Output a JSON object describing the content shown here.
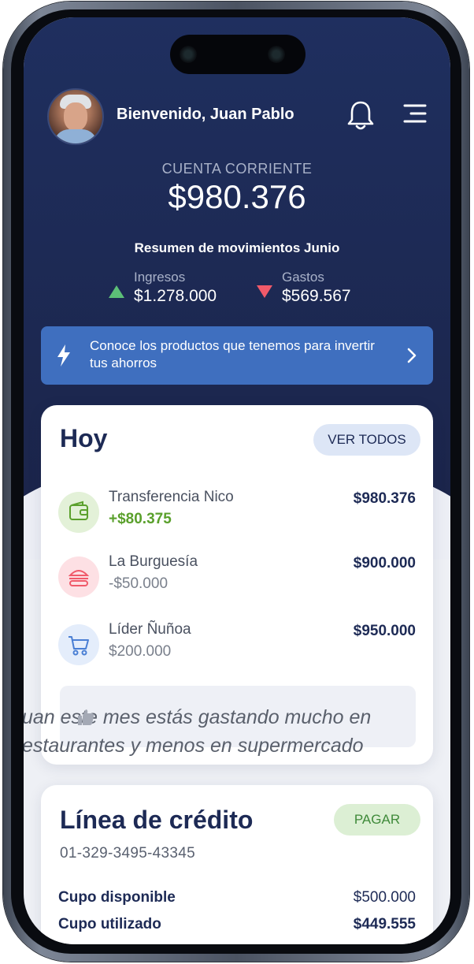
{
  "header": {
    "welcome": "Bienvenido, Juan Pablo"
  },
  "account": {
    "label": "CUENTA CORRIENTE",
    "balance": "$980.376"
  },
  "summary": {
    "title": "Resumen de movimientos Junio",
    "income_label": "Ingresos",
    "income_value": "$1.278.000",
    "expense_label": "Gastos",
    "expense_value": "$569.567"
  },
  "promo": {
    "text": "Conoce los productos que tenemos para invertir tus ahorros"
  },
  "today": {
    "title": "Hoy",
    "see_all": "VER TODOS",
    "transactions": [
      {
        "name": "Transferencia Nico",
        "sub": "+$80.375",
        "amount": "$980.376",
        "icon": "wallet-icon"
      },
      {
        "name": "La Burguesía",
        "sub": "-$50.000",
        "amount": "$900.000",
        "icon": "burger-icon"
      },
      {
        "name": "Líder Ñuñoa",
        "sub": "$200.000",
        "amount": "$950.000",
        "icon": "cart-icon"
      }
    ],
    "tip_line1": "uan este mes estás gastando mucho en",
    "tip_line2": "estaurantes y menos en supermercado"
  },
  "credit": {
    "title": "Línea de crédito",
    "pay": "PAGAR",
    "account_number": "01-329-3495-43345",
    "available_label": "Cupo disponible",
    "available_value": "$500.000",
    "used_label": "Cupo utilizado",
    "used_value": "$449.555"
  },
  "colors": {
    "hero": "#1d2a55",
    "promo": "#3f6fbf",
    "positive": "#5aa02c",
    "negative": "#f05a6a"
  }
}
